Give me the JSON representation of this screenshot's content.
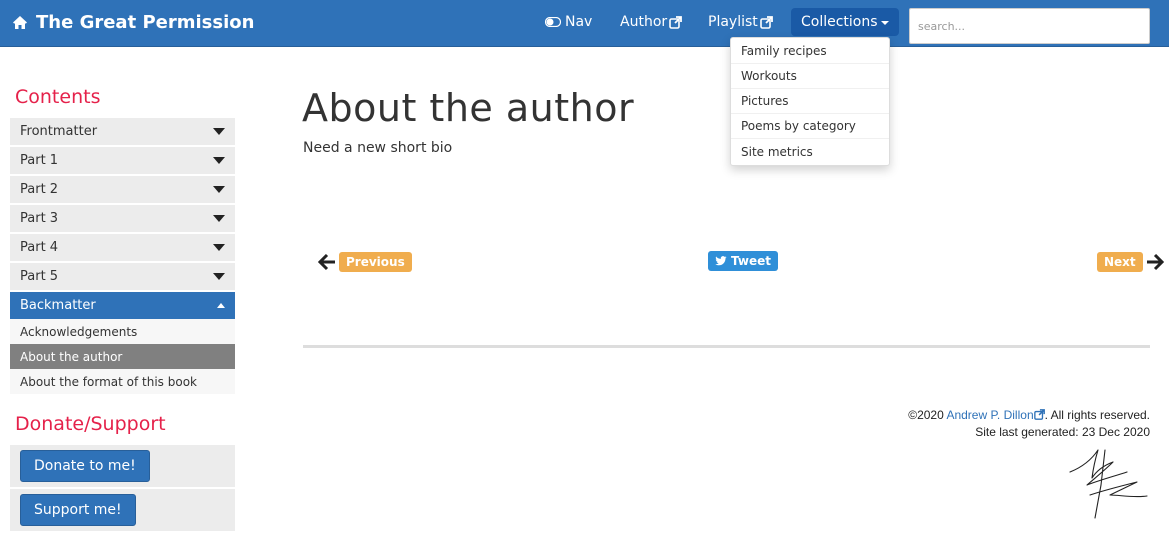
{
  "navbar": {
    "brand": "The Great Permission",
    "nav_label": "Nav",
    "author_label": "Author",
    "playlist_label": "Playlist",
    "collections_label": "Collections",
    "search_placeholder": "search..."
  },
  "collections_menu": {
    "items": [
      "Family recipes",
      "Workouts",
      "Pictures",
      "Poems by category",
      "Site metrics"
    ]
  },
  "sidebar": {
    "contents_heading": "Contents",
    "toc": [
      {
        "label": "Frontmatter"
      },
      {
        "label": "Part 1"
      },
      {
        "label": "Part 2"
      },
      {
        "label": "Part 3"
      },
      {
        "label": "Part 4"
      },
      {
        "label": "Part 5"
      },
      {
        "label": "Backmatter"
      }
    ],
    "backmatter_items": [
      "Acknowledgements",
      "About the author",
      "About the format of this book"
    ],
    "donate_heading": "Donate/Support",
    "donate_label": "Donate to me!",
    "support_label": "Support me!"
  },
  "main": {
    "title": "About the author",
    "body": "Need a new short bio",
    "previous_label": "Previous",
    "next_label": "Next",
    "tweet_label": "Tweet"
  },
  "footer": {
    "copyright_prefix": "©2020",
    "author_link": "Andrew P. Dillon",
    "rights": ". All rights reserved.",
    "generated": "Site last generated: 23 Dec 2020"
  },
  "colors": {
    "navbar": "#2f72b8",
    "accent_heading": "#e5214a",
    "badge": "#f0ad4e"
  },
  "icons": [
    "home-icon",
    "toggle-icon",
    "external-link-icon",
    "caret-down-icon",
    "arrow-left-icon",
    "arrow-right-icon",
    "twitter-icon",
    "signature-image"
  ]
}
